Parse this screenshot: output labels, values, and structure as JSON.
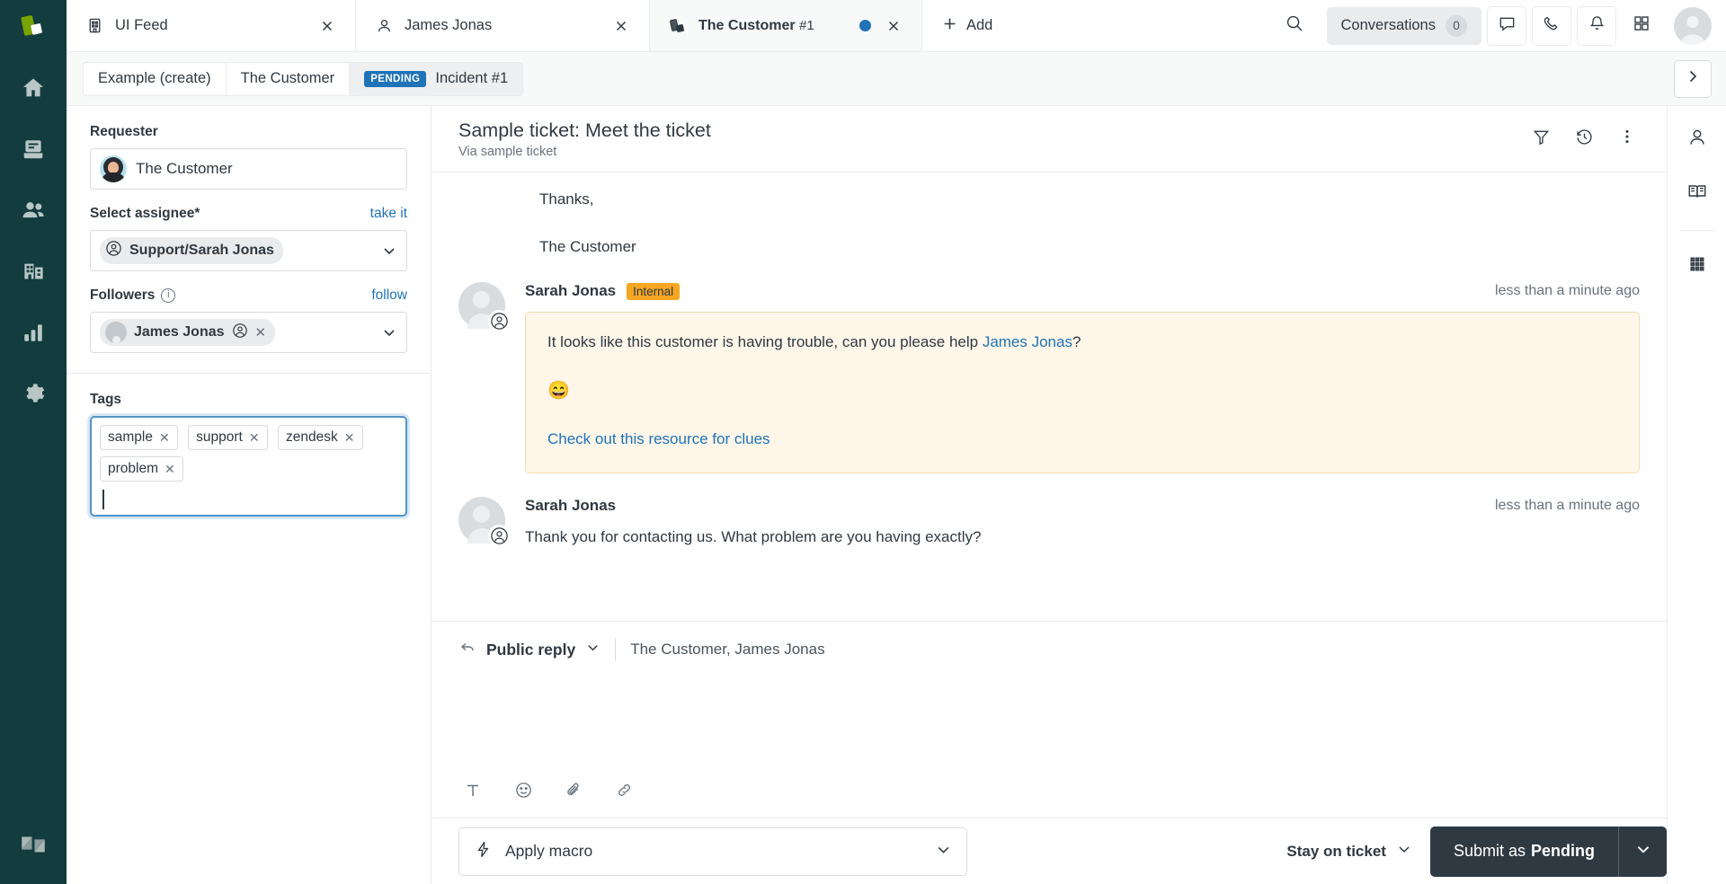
{
  "nav": {
    "logo_icon": "zendesk-mark-logo",
    "items": [
      {
        "name": "home",
        "icon": "home-icon"
      },
      {
        "name": "views",
        "icon": "views-inbox-icon"
      },
      {
        "name": "customers",
        "icon": "customers-people-icon"
      },
      {
        "name": "organizations",
        "icon": "organizations-building-icon"
      },
      {
        "name": "reporting",
        "icon": "reporting-bar-chart-icon"
      },
      {
        "name": "admin",
        "icon": "gear-icon"
      }
    ],
    "footer_logo_icon": "zendesk-z-logo"
  },
  "tabs": [
    {
      "label": "UI Feed",
      "sub": "",
      "icon": "building-icon",
      "active": false,
      "has_dot": false
    },
    {
      "label": "James Jonas",
      "sub": "",
      "icon": "user-icon",
      "active": false,
      "has_dot": false
    },
    {
      "label": "The Customer",
      "sub": "#1",
      "icon": "zendesk-ticket-icon",
      "active": true,
      "has_dot": true
    }
  ],
  "tabbar": {
    "add_label": "Add",
    "search_icon": "search-icon",
    "conversations_label": "Conversations",
    "conversations_count": "0",
    "chat_icon": "chat-bubble-icon",
    "call_icon": "phone-icon",
    "bell_icon": "bell-icon",
    "apps_icon": "apps-grid-icon",
    "avatar_icon": "user-avatar"
  },
  "breadcrumb": {
    "items": [
      {
        "label": "Example (create)",
        "badge": ""
      },
      {
        "label": "The Customer",
        "badge": ""
      },
      {
        "label": "Incident #1",
        "badge": "PENDING"
      }
    ],
    "next_icon": "chevron-right-icon"
  },
  "sidebar": {
    "requester": {
      "label": "Requester",
      "value": "The Customer",
      "avatar_name": "requester-avatar"
    },
    "assignee": {
      "label": "Select assignee*",
      "action_label": "take it",
      "value": "Support/Sarah Jonas",
      "token_icon": "agent-circle-icon"
    },
    "followers": {
      "label": "Followers",
      "info_icon": "info-icon",
      "action_label": "follow",
      "value": "James Jonas",
      "token_icon": "agent-circle-icon",
      "remove_icon": "close-icon"
    },
    "tags": {
      "label": "Tags",
      "values": [
        "sample",
        "support",
        "zendesk",
        "problem"
      ],
      "focused": true
    }
  },
  "ticket": {
    "title": "Sample ticket: Meet the ticket",
    "via": "Via sample ticket",
    "actions": [
      {
        "name": "filter-conversation",
        "icon": "filter-icon"
      },
      {
        "name": "conversation-history",
        "icon": "history-clock-icon"
      },
      {
        "name": "more-options",
        "icon": "more-vertical-icon"
      }
    ]
  },
  "conversation": {
    "tail_lines": [
      "Thanks,",
      "The Customer"
    ],
    "events": [
      {
        "author": "Sarah Jonas",
        "badge": "Internal",
        "time": "less than a minute ago",
        "internal": true,
        "text_before_link": "It looks like this customer is having trouble, can you please help ",
        "link_text": "James Jonas",
        "text_after_link": "?",
        "emoji": "😄",
        "resource_link": "Check out this resource for clues"
      },
      {
        "author": "Sarah Jonas",
        "badge": "",
        "time": "less than a minute ago",
        "internal": false,
        "body": "Thank you for contacting us. What problem are you having exactly?"
      }
    ]
  },
  "composer": {
    "reply_type": "Public reply",
    "reply_type_icon": "reply-arrow-icon",
    "recipients": "The Customer, James Jonas",
    "placeholder": "",
    "value": "",
    "tools": [
      {
        "name": "text-format",
        "icon": "text-format-icon",
        "glyph": "T"
      },
      {
        "name": "emoji",
        "icon": "emoji-icon"
      },
      {
        "name": "attachment",
        "icon": "paperclip-icon"
      },
      {
        "name": "link",
        "icon": "link-icon"
      }
    ]
  },
  "footer": {
    "macro_label": "Apply macro",
    "macro_icon": "lightning-icon",
    "stay_label": "Stay on ticket",
    "submit_prefix": "Submit as",
    "submit_state": "Pending"
  },
  "right_rail": [
    {
      "name": "customer-context",
      "icon": "user-icon"
    },
    {
      "name": "knowledge",
      "icon": "book-icon"
    },
    {
      "name": "apps",
      "icon": "apps-dots-icon"
    }
  ],
  "colors": {
    "brand_dark": "#123c3d",
    "accent_blue": "#1f73b7",
    "internal_amber": "#f5a623",
    "internal_bg": "#fdf6e9",
    "submit_dark": "#2f3941"
  }
}
